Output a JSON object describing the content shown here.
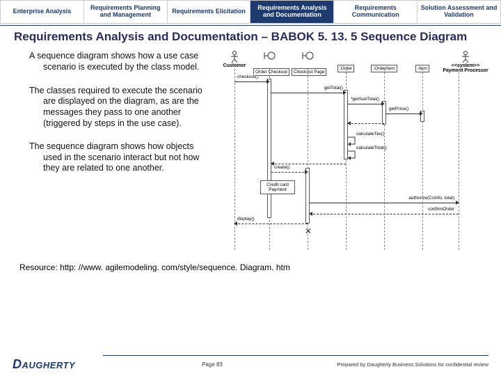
{
  "tabs": [
    {
      "label": "Enterprise Analysis",
      "active": false
    },
    {
      "label": "Requirements Planning and Management",
      "active": false
    },
    {
      "label": "Requirements Elicitation",
      "active": false
    },
    {
      "label": "Requirements Analysis and Documentation",
      "active": true
    },
    {
      "label": "Requirements Communication",
      "active": false
    },
    {
      "label": "Solution Assessment and Validation",
      "active": false
    }
  ],
  "title": "Requirements Analysis and Documentation – BABOK 5. 13. 5 Sequence Diagram",
  "paragraphs": [
    "A sequence diagram shows how a use case scenario is executed by the class model.",
    "The classes required to execute the scenario are displayed on the diagram, as are the messages they pass to one another (triggered by steps in the use case).",
    "The sequence diagram shows how objects used in the scenario interact but not how they are related to one another."
  ],
  "resource": "Resource: http: //www. agilemodeling. com/style/sequence. Diagram. htm",
  "footer": {
    "page": "Page 83",
    "confidential": "Prepared by Daugherty Business Solutions for confidential review",
    "logo_text": "AUGHERTY"
  },
  "diagram": {
    "lifelines": [
      {
        "name": "Customer",
        "type": "actor"
      },
      {
        "name": "Order Checkout",
        "type": "boundary"
      },
      {
        "name": "Checkout Page",
        "type": "boundary"
      },
      {
        "name": ":Order",
        "type": "object"
      },
      {
        "name": ":OrderItem",
        "type": "object"
      },
      {
        "name": ":Item",
        "type": "object"
      },
      {
        "name": "<<system>> Payment Processor",
        "type": "actor"
      }
    ],
    "messages": [
      {
        "label": "checkout()",
        "from": 0,
        "to": 1
      },
      {
        "label": "getTotal()",
        "from": 1,
        "to": 3
      },
      {
        "label": "*getSubTotal()",
        "from": 3,
        "to": 4
      },
      {
        "label": "getPrice()",
        "from": 4,
        "to": 5
      },
      {
        "label": "calculateTax()",
        "from": 3,
        "to": 3,
        "self": true
      },
      {
        "label": "calculateTotal()",
        "from": 3,
        "to": 3,
        "self": true
      },
      {
        "label": "create()",
        "from": 1,
        "to": 2
      },
      {
        "label": "display()",
        "from": 2,
        "to": 0,
        "return": true
      },
      {
        "label": "authorize(CcInfo, total)",
        "from": 2,
        "to": 6
      },
      {
        "label": "confirmOrder",
        "from": 6,
        "to": 2,
        "return": true
      }
    ],
    "note": "Credit card Payment"
  }
}
